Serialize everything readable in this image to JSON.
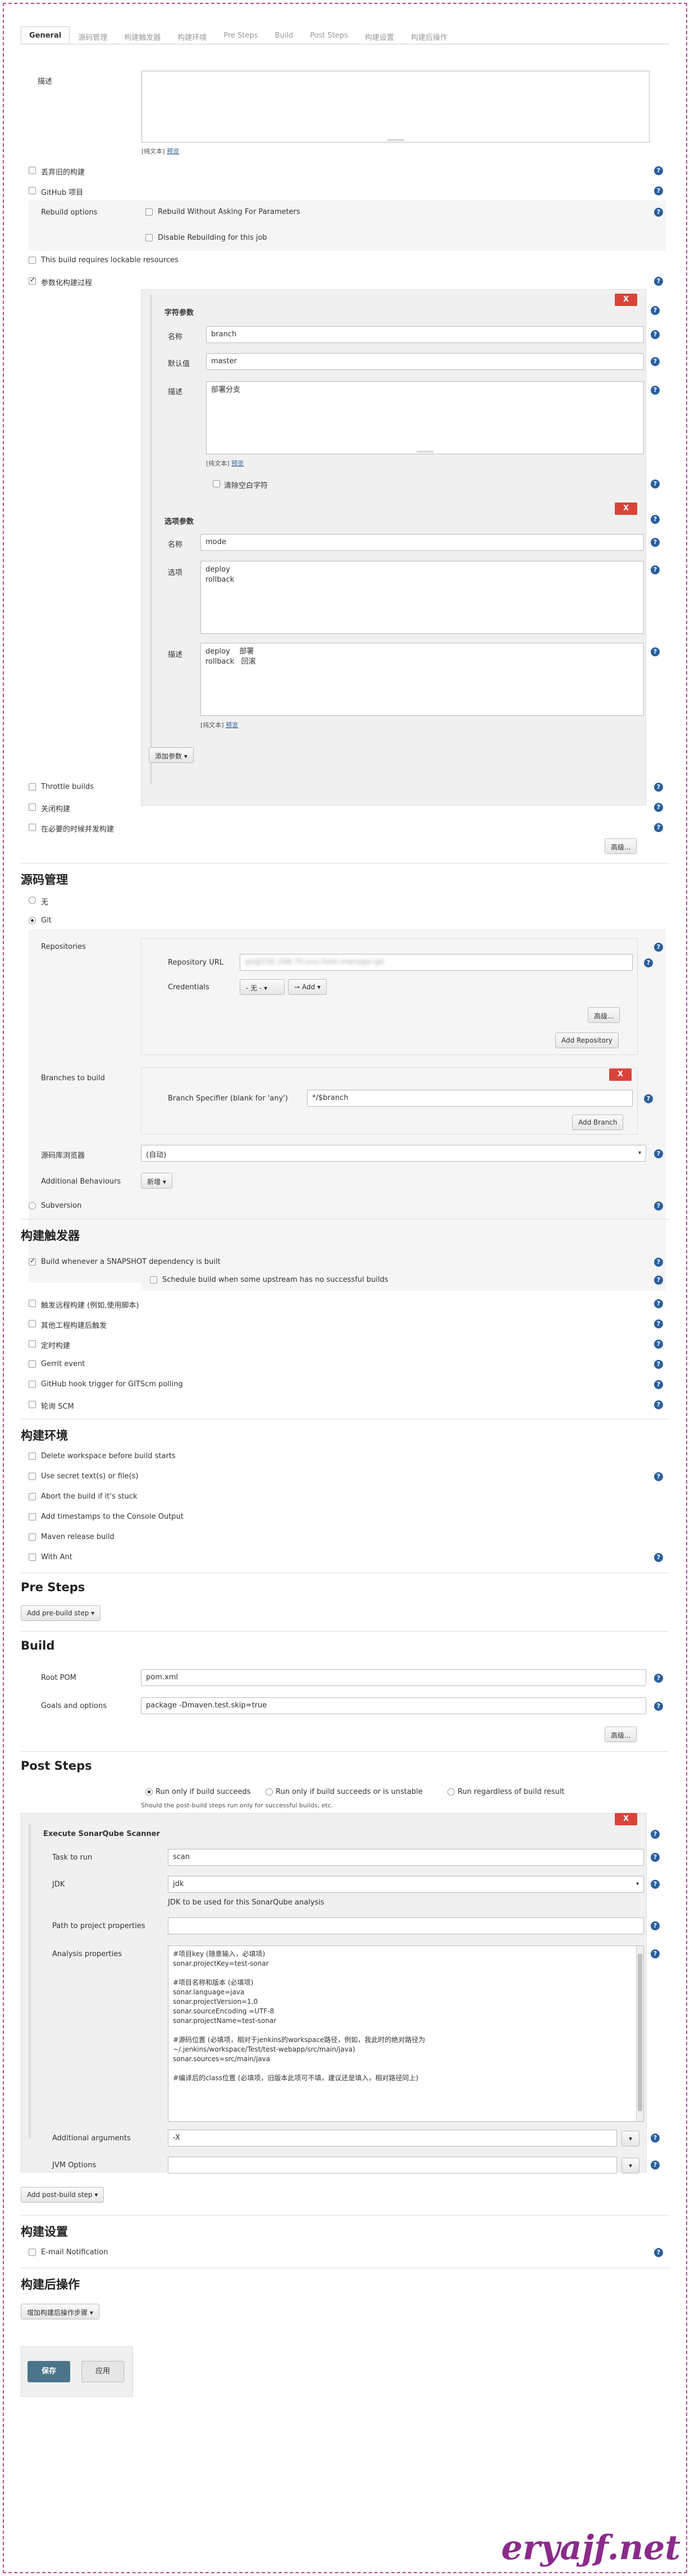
{
  "tabs": [
    "General",
    "源码管理",
    "构建触发器",
    "构建环境",
    "Pre Steps",
    "Build",
    "Post Steps",
    "构建设置",
    "构建后操作"
  ],
  "general": {
    "desc_label": "描述",
    "plain_text": "[纯文本]",
    "preview": "预览",
    "discard_label": "丢弃旧的构建",
    "github_label": "GitHub 项目",
    "rebuild_label": "Rebuild options",
    "rebuild_opt1": "Rebuild Without Asking For Parameters",
    "rebuild_opt2": "Disable Rebuilding for this job",
    "lockable_label": "This build requires lockable resources",
    "param_label": "参数化构建过程"
  },
  "string_param": {
    "title": "字符参数",
    "name_label": "名称",
    "name_value": "branch",
    "default_label": "默认值",
    "default_value": "master",
    "desc_label": "描述",
    "desc_value": "部署分支",
    "trim_label": "清除空白字符",
    "x": "X"
  },
  "choice_param": {
    "title": "选项参数",
    "name_label": "名称",
    "name_value": "mode",
    "options_label": "选项",
    "options_value": "deploy\nrollback",
    "desc_label": "描述",
    "desc_value": "deploy    部署\nrollback   回滚",
    "x": "X"
  },
  "add_param": "添加参数",
  "throttle_label": "Throttle builds",
  "disable_label": "关闭构建",
  "concurrent_label": "在必要的时候并发构建",
  "advanced": "高级...",
  "scm": {
    "title": "源码管理",
    "none": "无",
    "git": "Git",
    "repos_label": "Repositories",
    "repo_url_label": "Repository URL",
    "repo_url_value": "git@192.168.70.xxx:/test-manager.git",
    "cred_label": "Credentials",
    "cred_value": "- 无 -",
    "add_label": "Add",
    "advanced": "高级...",
    "add_repo": "Add Repository",
    "branches_label": "Branches to build",
    "spec_label": "Branch Specifier (blank for 'any')",
    "spec_value": "*/$branch",
    "add_branch": "Add Branch",
    "browser_label": "源码库浏览器",
    "browser_value": "(自动)",
    "behaviours_label": "Additional Behaviours",
    "behaviours_btn": "新增",
    "subversion": "Subversion",
    "x": "X"
  },
  "triggers": {
    "title": "构建触发器",
    "snapshot": "Build whenever a SNAPSHOT dependency is built",
    "schedule": "Schedule build when some upstream has no successful builds",
    "remote": "触发远程构建 (例如,使用脚本)",
    "after_others": "其他工程构建后触发",
    "periodic": "定时构建",
    "gerrit": "Gerrit event",
    "github_hook": "GitHub hook trigger for GITScm polling",
    "poll_scm": "轮询 SCM"
  },
  "env": {
    "title": "构建环境",
    "delete_ws": "Delete workspace before build starts",
    "secret": "Use secret text(s) or file(s)",
    "abort": "Abort the build if it's stuck",
    "timestamps": "Add timestamps to the Console Output",
    "maven_release": "Maven release build",
    "with_ant": "With Ant"
  },
  "pre_steps": {
    "title": "Pre Steps",
    "add_btn": "Add pre-build step"
  },
  "build": {
    "title": "Build",
    "root_pom_label": "Root POM",
    "root_pom_value": "pom.xml",
    "goals_label": "Goals and options",
    "goals_value": "package -Dmaven.test.skip=true",
    "advanced": "高级..."
  },
  "post_steps": {
    "title": "Post Steps",
    "opt1": "Run only if build succeeds",
    "opt2": "Run only if build succeeds or is unstable",
    "opt3": "Run regardless of build result",
    "note": "Should the post-build steps run only for successful builds, etc.",
    "sonar_title": "Execute SonarQube Scanner",
    "task_label": "Task to run",
    "task_value": "scan",
    "jdk_label": "JDK",
    "jdk_value": "jdk",
    "jdk_note": "JDK to be used for this SonarQube analysis",
    "path_label": "Path to project properties",
    "analysis_label": "Analysis properties",
    "analysis_value": "#项目key (随意输入，必填项)\nsonar.projectKey=test-sonar\n\n#项目名称和版本 (必填项)\nsonar.language=java\nsonar.projectVersion=1.0\nsonar.sourceEncoding =UTF-8\nsonar.projectName=test-sonar\n\n#源码位置 (必填项，相对于jenkins的workspace路径，例如，我此时的绝对路径为\n~/.jenkins/workspace/Test/test-webapp/src/main/java)\nsonar.sources=src/main/java\n\n#编译后的class位置 (必填项，旧版本此项可不填，建议还是填入，相对路径同上)",
    "args_label": "Additional arguments",
    "args_value": "-X",
    "jvm_label": "JVM Options",
    "add_post_btn": "Add post-build step",
    "x": "X"
  },
  "build_settings": {
    "title": "构建设置",
    "email": "E-mail Notification"
  },
  "post_build": {
    "title": "构建后操作",
    "add_btn": "增加构建后操作步骤"
  },
  "footer": {
    "save": "保存",
    "apply": "应用"
  },
  "watermark": "eryajf.net"
}
